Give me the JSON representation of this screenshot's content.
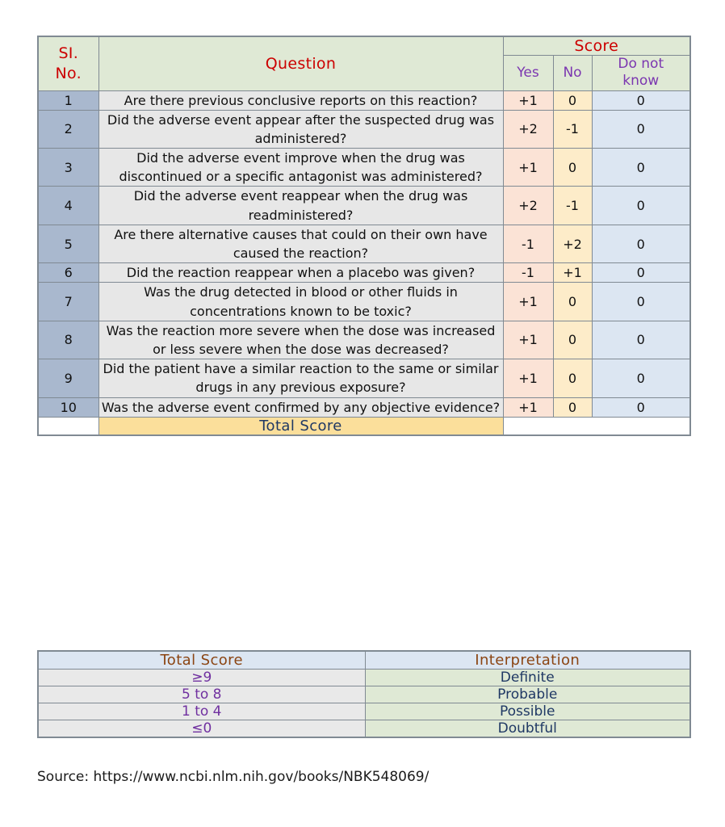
{
  "main_table": {
    "headers": {
      "sl_no_line1": "SI.",
      "sl_no_line2": "No.",
      "question": "Question",
      "score": "Score",
      "yes": "Yes",
      "no": "No",
      "do_not_know_line1": "Do not",
      "do_not_know_line2": "know"
    },
    "rows": [
      {
        "sl": "1",
        "question": "Are there previous conclusive reports on this reaction?",
        "yes": "+1",
        "no": "0",
        "dnk": "0"
      },
      {
        "sl": "2",
        "question": "Did the adverse event appear after the suspected drug was administered?",
        "yes": "+2",
        "no": "-1",
        "dnk": "0"
      },
      {
        "sl": "3",
        "question": "Did the adverse event improve when the drug was discontinued or a specific antagonist was administered?",
        "yes": "+1",
        "no": "0",
        "dnk": "0"
      },
      {
        "sl": "4",
        "question": "Did the adverse event reappear when the drug was readministered?",
        "yes": "+2",
        "no": "-1",
        "dnk": "0"
      },
      {
        "sl": "5",
        "question": "Are there alternative causes that could on their own have caused the reaction?",
        "yes": "-1",
        "no": "+2",
        "dnk": "0"
      },
      {
        "sl": "6",
        "question": "Did the reaction reappear when a placebo was given?",
        "yes": "-1",
        "no": "+1",
        "dnk": "0"
      },
      {
        "sl": "7",
        "question": "Was the drug detected in blood or other fluids in concentrations known to be toxic?",
        "yes": "+1",
        "no": "0",
        "dnk": "0"
      },
      {
        "sl": "8",
        "question": "Was the reaction more severe when the dose was increased or less severe when the dose was decreased?",
        "yes": "+1",
        "no": "0",
        "dnk": "0"
      },
      {
        "sl": "9",
        "question": "Did the patient have a similar reaction to the same or similar drugs in any previous exposure?",
        "yes": "+1",
        "no": "0",
        "dnk": "0"
      },
      {
        "sl": "10",
        "question": "Was the adverse event confirmed by any objective evidence?",
        "yes": "+1",
        "no": "0",
        "dnk": "0"
      }
    ],
    "total_row": {
      "sl": "",
      "label": "Total Score",
      "value": ""
    }
  },
  "interpretation_table": {
    "headers": {
      "total_score": "Total Score",
      "interpretation": "Interpretation"
    },
    "rows": [
      {
        "score": "≥9",
        "interpretation": "Definite"
      },
      {
        "score": "5 to 8",
        "interpretation": "Probable"
      },
      {
        "score": "1 to 4",
        "interpretation": "Possible"
      },
      {
        "score": "≤0",
        "interpretation": "Doubtful"
      }
    ]
  },
  "source": {
    "text": "Source: https://www.ncbi.nlm.nih.gov/books/NBK548069/"
  },
  "colors": {
    "header_green": "#dfe9d5",
    "header_red_text": "#cc0000",
    "subheader_purple_text": "#7b36b0",
    "sl_no_blue_gray": "#a9b8ce",
    "question_gray": "#e7e7e7",
    "yes_peach": "#fbe3d6",
    "no_cream": "#fdecc9",
    "dnk_blue": "#dce6f2",
    "total_amber": "#fbdf9b",
    "total_navy_text": "#1f3864",
    "interp_header_blue": "#dce6f2",
    "interp_header_brown_text": "#8b4513",
    "interp_score_purple_text": "#7030a0",
    "border_gray": "#808a93"
  }
}
